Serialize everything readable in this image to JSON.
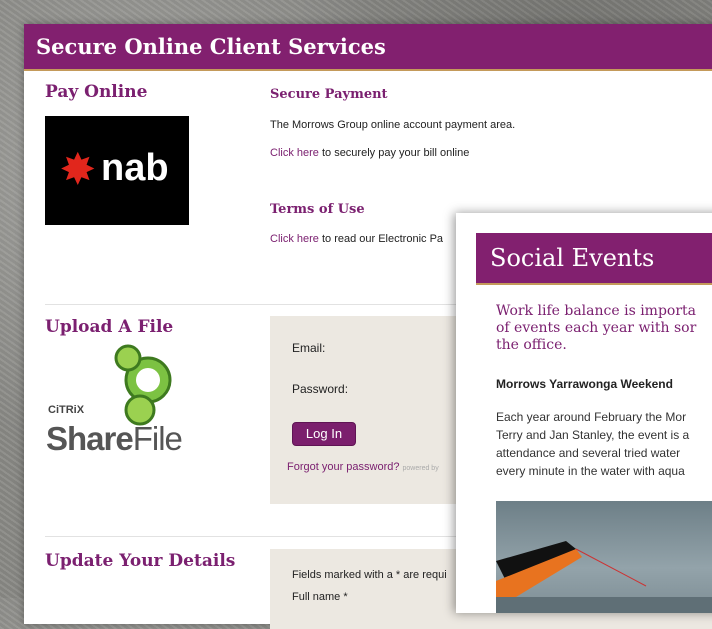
{
  "main": {
    "header_title": "Secure Online Client Services",
    "pay_online": {
      "heading": "Pay Online",
      "logo_text": "nab",
      "secure_payment_heading": "Secure Payment",
      "secure_payment_text": "The Morrows Group online account payment area.",
      "click_here_1": "Click here",
      "pay_text": " to securely pay your bill online",
      "terms_heading": "Terms of Use",
      "click_here_2": "Click here",
      "terms_text": " to read our Electronic Pa"
    },
    "upload": {
      "heading": "Upload A File",
      "citrix_text": "CiTRiX",
      "sharefile_share": "Share",
      "sharefile_file": "File",
      "email_label": "Email:",
      "password_label": "Password:",
      "login_button": "Log In",
      "forgot_link": "Forgot your password?",
      "powered_text": "powered by"
    },
    "update": {
      "heading": "Update Your Details",
      "fields_note": "Fields marked with a * are requi",
      "full_name_label": "Full name *"
    }
  },
  "social": {
    "header_title": "Social Events",
    "intro_lines": [
      "Work life balance is importa",
      "of events each year with sor",
      "the office."
    ],
    "event_title": "Morrows Yarrawonga Weekend",
    "event_lines": [
      "Each year around February the Mor",
      "Terry and Jan Stanley, the event is a",
      "attendance and several tried water",
      "every minute in the water with aqua"
    ]
  },
  "colors": {
    "brand_purple": "#82206f",
    "accent_gold": "#c49a5a",
    "nab_red": "#e1261c",
    "sharefile_green": "#7cc242"
  }
}
